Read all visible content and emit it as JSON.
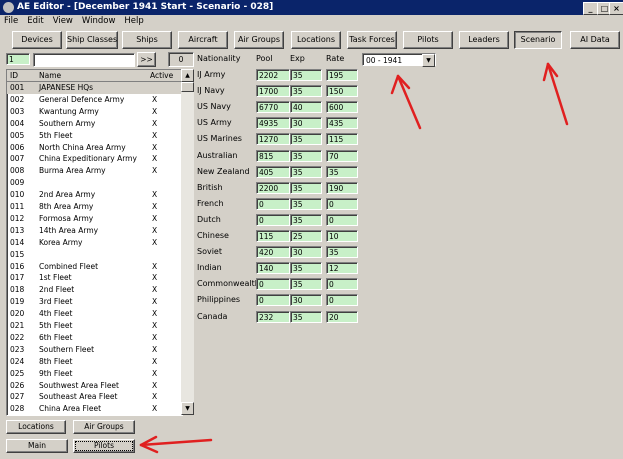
{
  "window": {
    "title": "AE Editor - [December 1941 Start - Scenario - 028]",
    "controls": {
      "minimize": "_",
      "maximize": "□",
      "close": "×"
    }
  },
  "menu": [
    "File",
    "Edit",
    "View",
    "Window",
    "Help"
  ],
  "toolbar": [
    "Devices",
    "Ship Classes",
    "Ships",
    "Aircraft",
    "Air Groups",
    "Locations",
    "Task Forces",
    "Pilots",
    "Leaders",
    "Scenario",
    "AI Data"
  ],
  "toolbar_pressed": "Scenario",
  "search": {
    "id_value": "1",
    "text_value": "",
    "go_label": ">>",
    "count": "0"
  },
  "list": {
    "headers": {
      "id": "ID",
      "name": "Name",
      "active": "Active"
    },
    "rows": [
      {
        "id": "001",
        "name": "JAPANESE HQs",
        "active": ""
      },
      {
        "id": "002",
        "name": "General Defence Army",
        "active": "X"
      },
      {
        "id": "003",
        "name": "Kwantung Army",
        "active": "X"
      },
      {
        "id": "004",
        "name": "Southern Army",
        "active": "X"
      },
      {
        "id": "005",
        "name": "5th Fleet",
        "active": "X"
      },
      {
        "id": "006",
        "name": "North China Area Army",
        "active": "X"
      },
      {
        "id": "007",
        "name": "China Expeditionary Army",
        "active": "X"
      },
      {
        "id": "008",
        "name": "Burma Area Army",
        "active": "X"
      },
      {
        "id": "009",
        "name": "",
        "active": ""
      },
      {
        "id": "010",
        "name": "2nd Area Army",
        "active": "X"
      },
      {
        "id": "011",
        "name": "8th Area Army",
        "active": "X"
      },
      {
        "id": "012",
        "name": "Formosa Army",
        "active": "X"
      },
      {
        "id": "013",
        "name": "14th Area Army",
        "active": "X"
      },
      {
        "id": "014",
        "name": "Korea Army",
        "active": "X"
      },
      {
        "id": "015",
        "name": "",
        "active": ""
      },
      {
        "id": "016",
        "name": "Combined Fleet",
        "active": "X"
      },
      {
        "id": "017",
        "name": "1st Fleet",
        "active": "X"
      },
      {
        "id": "018",
        "name": "2nd Fleet",
        "active": "X"
      },
      {
        "id": "019",
        "name": "3rd Fleet",
        "active": "X"
      },
      {
        "id": "020",
        "name": "4th Fleet",
        "active": "X"
      },
      {
        "id": "021",
        "name": "5th Fleet",
        "active": "X"
      },
      {
        "id": "022",
        "name": "6th Fleet",
        "active": "X"
      },
      {
        "id": "023",
        "name": "Southern Fleet",
        "active": "X"
      },
      {
        "id": "024",
        "name": "8th Fleet",
        "active": "X"
      },
      {
        "id": "025",
        "name": "9th Fleet",
        "active": "X"
      },
      {
        "id": "026",
        "name": "Southwest Area Fleet",
        "active": "X"
      },
      {
        "id": "027",
        "name": "Southeast Area Fleet",
        "active": "X"
      },
      {
        "id": "028",
        "name": "China Area Fleet",
        "active": "X"
      }
    ]
  },
  "bottom_buttons": {
    "locations": "Locations",
    "air_groups": "Air Groups",
    "main": "Main",
    "pilots": "Pilots"
  },
  "grid": {
    "headers": {
      "nationality": "Nationality",
      "pool": "Pool",
      "exp": "Exp",
      "rate": "Rate"
    },
    "rows": [
      {
        "nation": "IJ Army",
        "pool": "2202",
        "exp": "35",
        "rate": "195"
      },
      {
        "nation": "IJ Navy",
        "pool": "1700",
        "exp": "35",
        "rate": "150"
      },
      {
        "nation": "US Navy",
        "pool": "6770",
        "exp": "40",
        "rate": "600"
      },
      {
        "nation": "US Army",
        "pool": "4935",
        "exp": "30",
        "rate": "435"
      },
      {
        "nation": "US Marines",
        "pool": "1270",
        "exp": "35",
        "rate": "115"
      },
      {
        "nation": "Australian",
        "pool": "815",
        "exp": "35",
        "rate": "70"
      },
      {
        "nation": "New Zealand",
        "pool": "405",
        "exp": "35",
        "rate": "35"
      },
      {
        "nation": "British",
        "pool": "2200",
        "exp": "35",
        "rate": "190"
      },
      {
        "nation": "French",
        "pool": "0",
        "exp": "35",
        "rate": "0"
      },
      {
        "nation": "Dutch",
        "pool": "0",
        "exp": "35",
        "rate": "0"
      },
      {
        "nation": "Chinese",
        "pool": "115",
        "exp": "25",
        "rate": "10"
      },
      {
        "nation": "Soviet",
        "pool": "420",
        "exp": "30",
        "rate": "35"
      },
      {
        "nation": "Indian",
        "pool": "140",
        "exp": "35",
        "rate": "12"
      },
      {
        "nation": "Commonwealth",
        "pool": "0",
        "exp": "35",
        "rate": "0"
      },
      {
        "nation": "Philippines",
        "pool": "0",
        "exp": "30",
        "rate": "0"
      },
      {
        "nation": "Canada",
        "pool": "232",
        "exp": "35",
        "rate": "20"
      }
    ]
  },
  "scenario_dropdown": {
    "value": "00 - 1941",
    "arrow": "▼"
  },
  "scroll": {
    "up": "▲",
    "down": "▼"
  },
  "colors": {
    "titlebar": "#0a246a",
    "field": "#c8f0c8",
    "annotation_arrow": "#e02020"
  }
}
